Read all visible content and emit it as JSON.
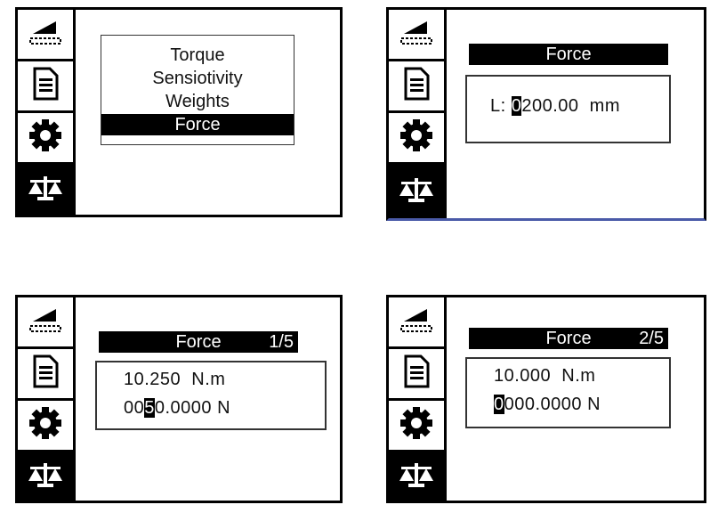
{
  "icons": [
    "level-icon",
    "document-icon",
    "gear-icon",
    "balance-scale-icon"
  ],
  "menu": {
    "items": [
      "Torque",
      "Sensiotivity",
      "Weights",
      "Force"
    ],
    "selected": "Force"
  },
  "screen2": {
    "title": "Force",
    "length_label": "L:",
    "length_cursor_digit": "0",
    "length_rest": "200.00",
    "length_unit": "mm"
  },
  "screen3": {
    "title": "Force",
    "page": "1/5",
    "torque": "10.250",
    "torque_unit": "N.m",
    "force_before_cursor": "00",
    "force_cursor_digit": "5",
    "force_after_cursor": "0.0000",
    "force_unit": "N"
  },
  "screen4": {
    "title": "Force",
    "page": "2/5",
    "torque": "10.000",
    "torque_unit": "N.m",
    "force_cursor_digit": "0",
    "force_after_cursor": "000.0000",
    "force_unit": "N"
  }
}
